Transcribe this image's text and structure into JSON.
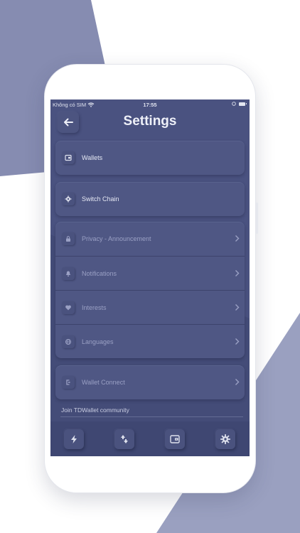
{
  "status_bar": {
    "carrier": "Không có SIM",
    "time": "17:55"
  },
  "header": {
    "title": "Settings"
  },
  "menu": {
    "wallets": "Wallets",
    "switch_chain": "Switch Chain",
    "privacy": "Privacy - Announcement",
    "notifications": "Notifications",
    "interests": "Interests",
    "languages": "Languages",
    "wallet_connect": "Wallet Connect"
  },
  "footer": {
    "community": "Join TDWallet community"
  },
  "colors": {
    "screen": "#444c78",
    "card": "#4f5784",
    "tabbar": "#3f4772",
    "text": "#e6e9f4",
    "accent_bg": "#8289b1"
  },
  "icons": [
    "back-arrow-icon",
    "wallet-icon",
    "gear-icon",
    "lock-icon",
    "bell-icon",
    "heart-icon",
    "globe-icon",
    "link-icon",
    "lightning-icon",
    "swap-icon"
  ]
}
